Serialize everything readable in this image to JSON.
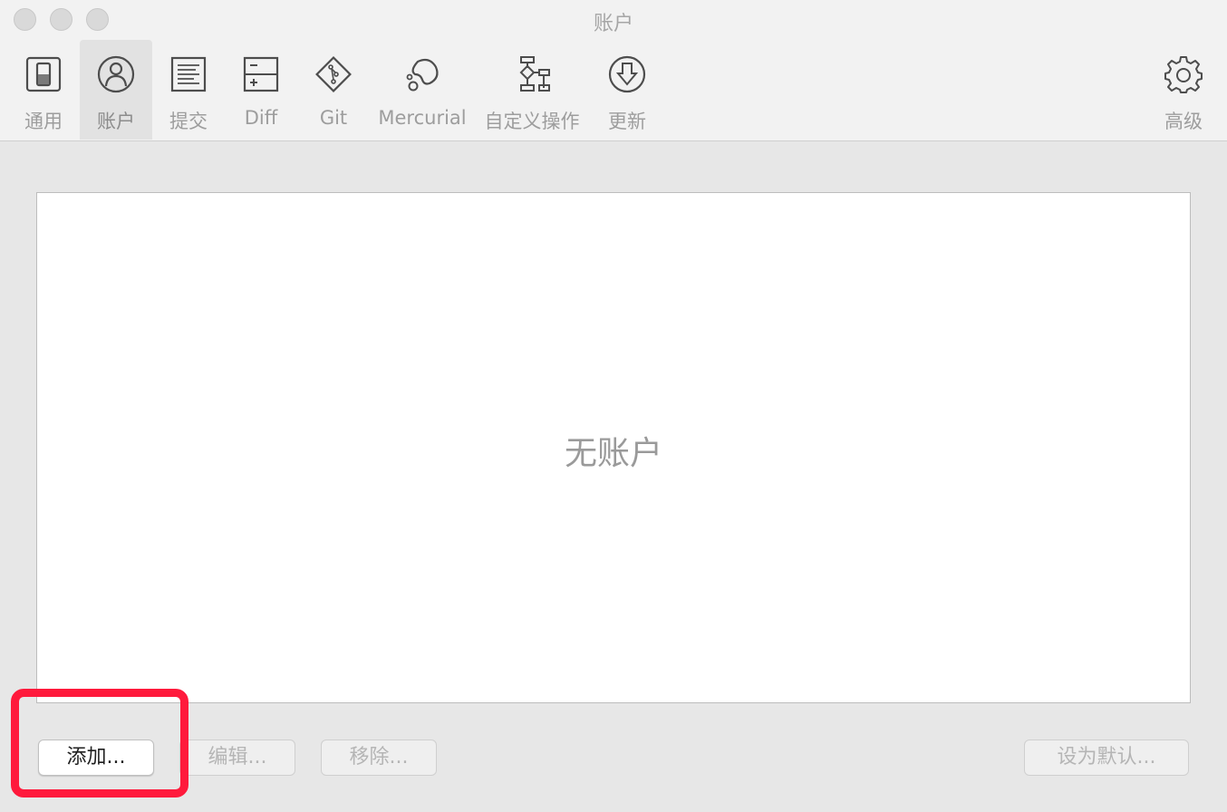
{
  "window": {
    "title": "账户"
  },
  "toolbar": {
    "items": [
      {
        "label": "通用",
        "icon": "switch-icon"
      },
      {
        "label": "账户",
        "icon": "user-circle-icon",
        "active": true
      },
      {
        "label": "提交",
        "icon": "document-lines-icon"
      },
      {
        "label": "Diff",
        "icon": "diff-icon"
      },
      {
        "label": "Git",
        "icon": "git-branch-icon"
      },
      {
        "label": "Mercurial",
        "icon": "mercurial-icon"
      },
      {
        "label": "自定义操作",
        "icon": "flowchart-icon"
      },
      {
        "label": "更新",
        "icon": "download-circle-icon"
      },
      {
        "label": "高级",
        "icon": "gear-icon"
      }
    ]
  },
  "accounts": {
    "empty_text": "无账户"
  },
  "buttons": {
    "add": "添加...",
    "edit": "编辑...",
    "remove": "移除...",
    "set_default": "设为默认..."
  },
  "colors": {
    "highlight": "#ff1a3c"
  }
}
